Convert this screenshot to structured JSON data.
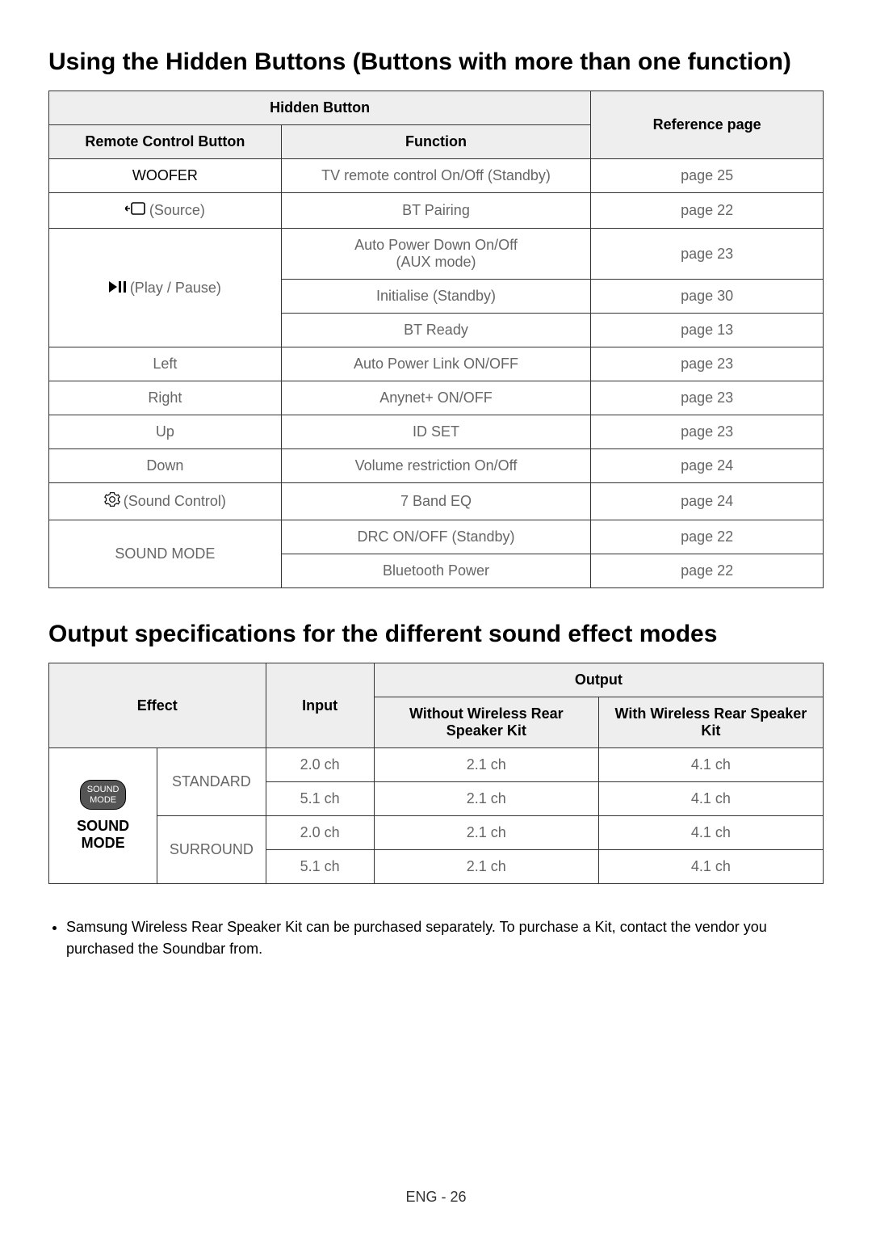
{
  "heading1": "Using the Hidden Buttons (Buttons with more than one function)",
  "table1": {
    "header_hidden_button": "Hidden Button",
    "header_remote": "Remote Control Button",
    "header_function": "Function",
    "header_ref": "Reference page",
    "rows": [
      {
        "button": "WOOFER",
        "function": "TV remote control On/Off (Standby)",
        "ref": "page 25",
        "icon": null
      },
      {
        "button": "(Source)",
        "function": "BT Pairing",
        "ref": "page 22",
        "icon": "source"
      },
      {
        "button": "(Play / Pause)",
        "function_a": "Auto Power Down On/Off\n(AUX mode)",
        "ref_a": "page 23",
        "function_b": "Initialise (Standby)",
        "ref_b": "page 30",
        "function_c": "BT Ready",
        "ref_c": "page 13",
        "icon": "playpause"
      },
      {
        "button": "Left",
        "function": "Auto Power Link ON/OFF",
        "ref": "page 23"
      },
      {
        "button": "Right",
        "function": "Anynet+ ON/OFF",
        "ref": "page 23"
      },
      {
        "button": "Up",
        "function": "ID SET",
        "ref": "page 23"
      },
      {
        "button": "Down",
        "function": "Volume restriction On/Off",
        "ref": "page 24"
      },
      {
        "button": "(Sound Control)",
        "function": "7 Band EQ",
        "ref": "page 24",
        "icon": "gear"
      },
      {
        "button": "SOUND MODE",
        "function_a": "DRC ON/OFF (Standby)",
        "ref_a": "page 22",
        "function_b": "Bluetooth Power",
        "ref_b": "page 22"
      }
    ]
  },
  "heading2": "Output specifications for the different sound effect modes",
  "table2": {
    "header_effect": "Effect",
    "header_input": "Input",
    "header_output": "Output",
    "header_without": "Without Wireless Rear Speaker Kit",
    "header_with": "With Wireless Rear Speaker Kit",
    "badge_line1": "SOUND",
    "badge_line2": "MODE",
    "sound_mode_label": "SOUND MODE",
    "groups": [
      {
        "mode": "STANDARD",
        "rows": [
          {
            "input": "2.0 ch",
            "without": "2.1 ch",
            "with": "4.1 ch"
          },
          {
            "input": "5.1 ch",
            "without": "2.1 ch",
            "with": "4.1 ch"
          }
        ]
      },
      {
        "mode": "SURROUND",
        "rows": [
          {
            "input": "2.0 ch",
            "without": "2.1 ch",
            "with": "4.1 ch"
          },
          {
            "input": "5.1 ch",
            "without": "2.1 ch",
            "with": "4.1 ch"
          }
        ]
      }
    ]
  },
  "note": "Samsung Wireless Rear Speaker Kit can be purchased separately. To purchase a Kit, contact the vendor you purchased the Soundbar from.",
  "footer": "ENG - 26"
}
